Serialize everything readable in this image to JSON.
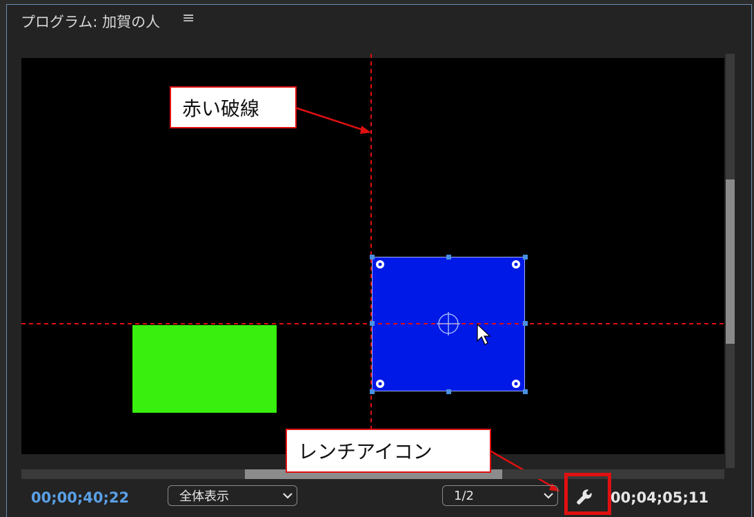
{
  "panel": {
    "title": "プログラム: 加賀の人",
    "menu_icon": "hamburger-menu-icon"
  },
  "viewer": {
    "background": "#000000",
    "green_shape_color": "#39ef0e",
    "blue_shape_color": "#0019e6",
    "guide_color": "#e01010"
  },
  "footer": {
    "current_timecode": "00;00;40;22",
    "zoom_label": "全体表示",
    "resolution_label": "1/2",
    "duration_timecode": "00;04;05;11",
    "settings_icon": "wrench-icon"
  },
  "annotations": {
    "dashed_line_label": "赤い破線",
    "wrench_label": "レンチアイコン",
    "accent_color": "#e01010"
  }
}
